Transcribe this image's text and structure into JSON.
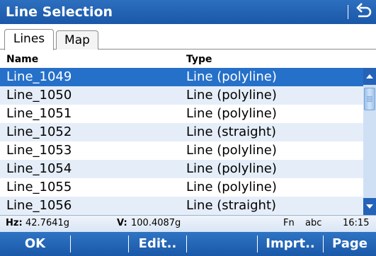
{
  "window": {
    "title": "Line Selection",
    "back_icon": "back-arrow-icon"
  },
  "tabs": [
    {
      "label": "Lines",
      "active": true
    },
    {
      "label": "Map",
      "active": false
    }
  ],
  "table": {
    "columns": [
      "Name",
      "Type"
    ],
    "selected_index": 0,
    "rows": [
      {
        "name": "Line_1049",
        "type": "Line (polyline)"
      },
      {
        "name": "Line_1050",
        "type": "Line (polyline)"
      },
      {
        "name": "Line_1051",
        "type": "Line (polyline)"
      },
      {
        "name": "Line_1052",
        "type": "Line (straight)"
      },
      {
        "name": "Line_1053",
        "type": "Line (polyline)"
      },
      {
        "name": "Line_1054",
        "type": "Line (polyline)"
      },
      {
        "name": "Line_1055",
        "type": "Line (polyline)"
      },
      {
        "name": "Line_1056",
        "type": "Line (straight)"
      }
    ]
  },
  "status": {
    "hz_label": "Hz:",
    "hz_value": "42.7641g",
    "v_label": "V:",
    "v_value": "100.4087g",
    "fn": "Fn",
    "input_mode": "abc",
    "time": "16:15"
  },
  "softkeys": {
    "f1": "OK",
    "f2": "",
    "f3": "Edit..",
    "f4": "",
    "f5": "Imprt..",
    "f6": "Page"
  },
  "colors": {
    "title_bar": "#1f62b3",
    "selection": "#2570c9",
    "alt_row": "#e5eef8"
  }
}
